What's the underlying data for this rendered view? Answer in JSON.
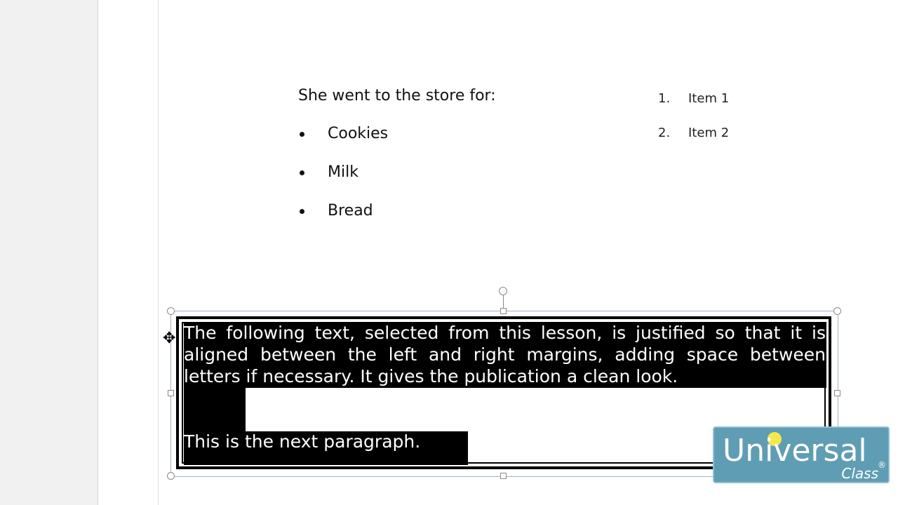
{
  "document": {
    "intro": "She went to the store for:",
    "bullets": [
      "Cookies",
      "Milk",
      "Bread"
    ],
    "numbered": [
      {
        "num": "1.",
        "label": "Item 1"
      },
      {
        "num": "2.",
        "label": "Item 2"
      }
    ]
  },
  "textbox": {
    "paragraph1": "The following text, selected from this lesson, is justified so that it is aligned between the left and right margins, adding space between letters if necessary. It gives the publication a clean look.",
    "paragraph2": "This is the next paragraph."
  },
  "logo": {
    "main": "Universal",
    "sub": "Class",
    "reg": "®"
  },
  "icons": {
    "bullet": "bullet-dot-icon",
    "move_cursor": "move-cursor-icon",
    "bulb": "lightbulb-icon"
  }
}
